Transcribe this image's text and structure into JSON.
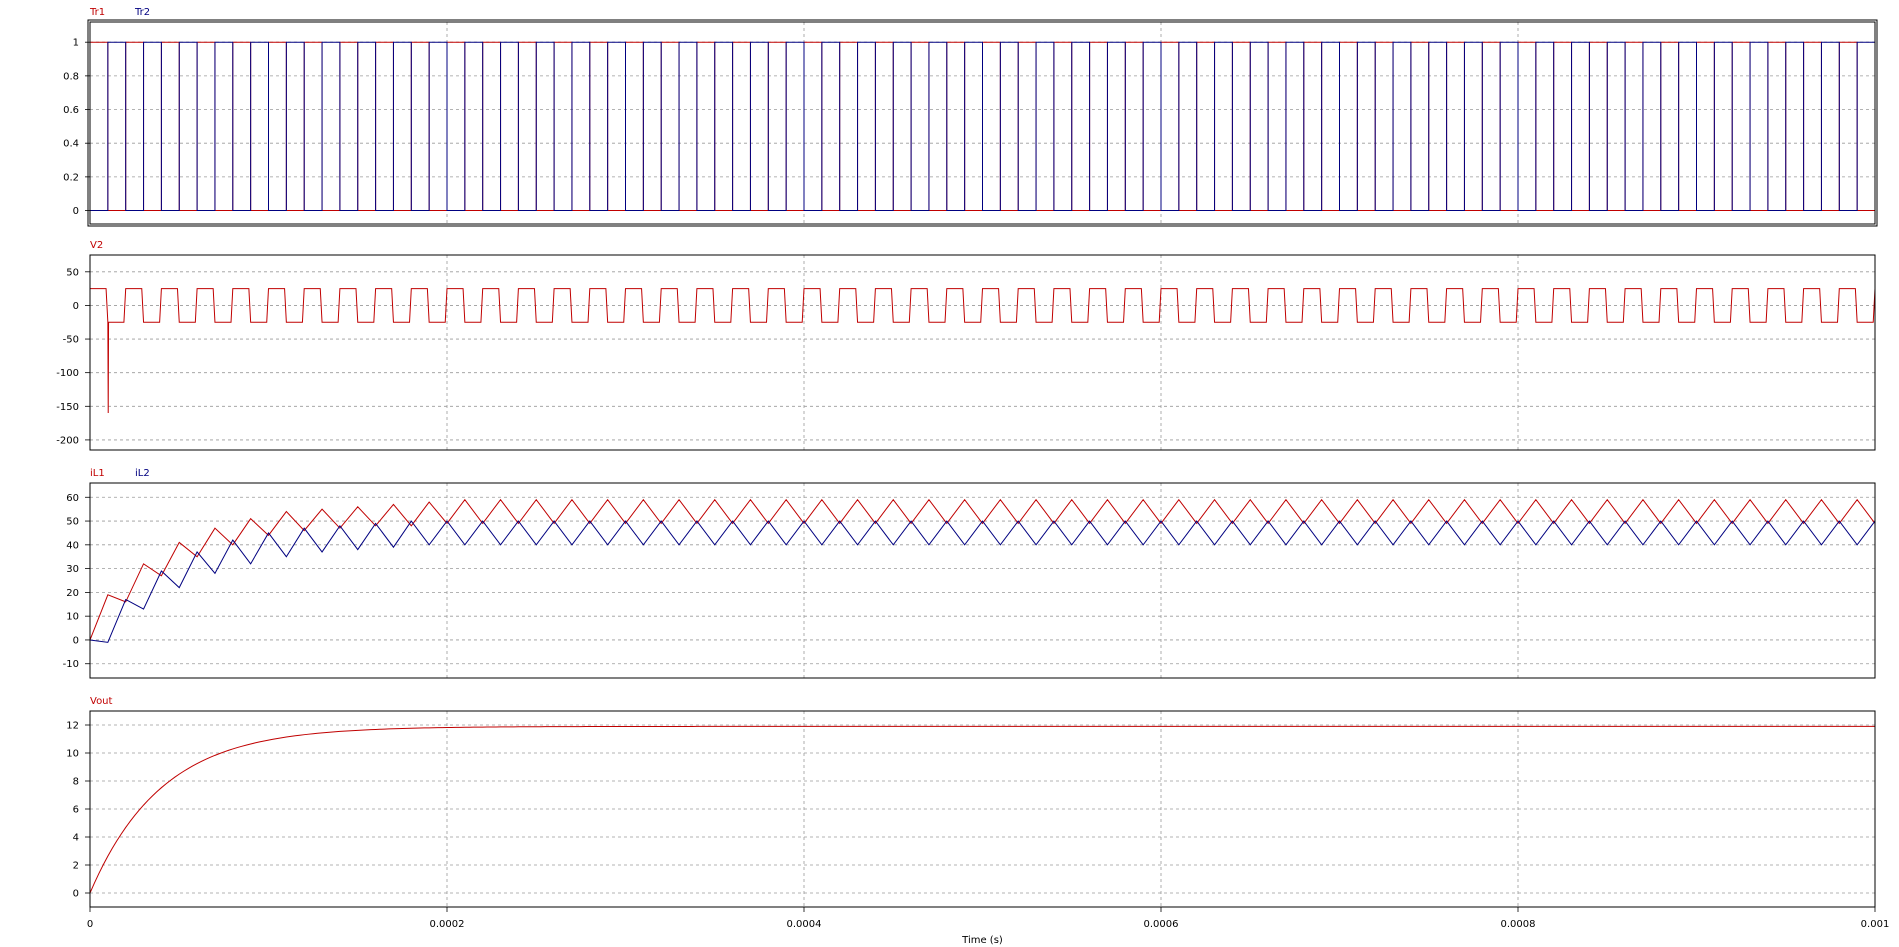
{
  "chart_data": [
    {
      "type": "line",
      "panel": "Tr1 / Tr2",
      "series": [
        {
          "name": "Tr1",
          "color": "#c00000",
          "waveform": "pulse",
          "period": 2e-05,
          "duty": 0.5,
          "phase": 0.0,
          "low": 0,
          "high": 1
        },
        {
          "name": "Tr2",
          "color": "#000080",
          "waveform": "pulse",
          "period": 2e-05,
          "duty": 0.5,
          "phase": 0.5,
          "low": 0,
          "high": 1
        }
      ],
      "yticks": [
        "0",
        "0.2",
        "0.4",
        "0.6",
        "0.8",
        "1"
      ],
      "ylim": [
        -0.08,
        1.12
      ],
      "grid": true
    },
    {
      "type": "line",
      "panel": "V2",
      "series": [
        {
          "name": "V2",
          "color": "#c00000",
          "waveform": "square",
          "period": 2e-05,
          "high": 25,
          "low": -25,
          "startup_spike": [
            1e-05,
            -160
          ]
        }
      ],
      "yticks": [
        "-200",
        "-150",
        "-100",
        "-50",
        "0",
        "50"
      ],
      "ylim": [
        -215,
        75
      ],
      "grid": true
    },
    {
      "type": "line",
      "panel": "iL1 / iL2",
      "series": [
        {
          "name": "iL1",
          "color": "#c00000",
          "waveform": "triangle",
          "period": 2e-05,
          "start": 0,
          "steady_max": 59,
          "steady_min": 49,
          "x": [
            0,
            1e-05,
            2e-05,
            3e-05,
            4e-05,
            5e-05,
            6e-05,
            7e-05,
            8e-05,
            9e-05,
            0.0001,
            0.00011,
            0.00012,
            0.00013,
            0.00014,
            0.00015,
            0.00016,
            0.00017,
            0.00018,
            0.00019,
            0.0002
          ],
          "y": [
            0,
            19,
            16,
            32,
            27,
            41,
            35,
            47,
            40,
            51,
            44,
            54,
            46,
            55,
            47,
            56,
            48,
            57,
            48,
            58,
            49
          ]
        },
        {
          "name": "iL2",
          "color": "#000080",
          "waveform": "triangle",
          "period": 2e-05,
          "start": 0,
          "steady_max": 50,
          "steady_min": 40,
          "x": [
            0,
            1e-05,
            2e-05,
            3e-05,
            4e-05,
            5e-05,
            6e-05,
            7e-05,
            8e-05,
            9e-05,
            0.0001,
            0.00011,
            0.00012,
            0.00013,
            0.00014,
            0.00015,
            0.00016,
            0.00017,
            0.00018,
            0.00019,
            0.0002
          ],
          "y": [
            0,
            -1,
            17,
            13,
            29,
            22,
            37,
            28,
            42,
            32,
            45,
            35,
            47,
            37,
            48,
            38,
            49,
            39,
            50,
            40,
            50
          ]
        }
      ],
      "yticks": [
        "-10",
        "0",
        "10",
        "20",
        "30",
        "40",
        "50",
        "60"
      ],
      "ylim": [
        -16,
        66
      ],
      "grid": true
    },
    {
      "type": "line",
      "panel": "Vout",
      "series": [
        {
          "name": "Vout",
          "color": "#c00000",
          "waveform": "exp_rise",
          "final": 11.9,
          "tau": 4e-05
        }
      ],
      "yticks": [
        "0",
        "2",
        "4",
        "6",
        "8",
        "10",
        "12"
      ],
      "ylim": [
        -1.0,
        13.0
      ],
      "grid": true
    }
  ],
  "x_axis": {
    "xlim": [
      0,
      0.001
    ],
    "ticks": [
      "0",
      "0.0002",
      "0.0004",
      "0.0006",
      "0.0008",
      "0.001"
    ],
    "label": "Time (s)"
  }
}
